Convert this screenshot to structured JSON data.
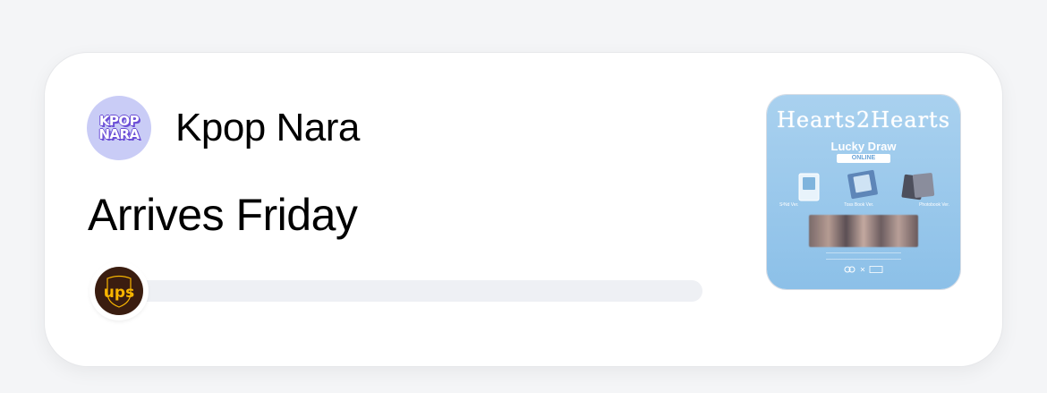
{
  "order": {
    "store": {
      "name": "Kpop Nara",
      "logo_text_line1": "KPOP",
      "logo_text_line2": "NARA",
      "logo_background": "#c9ccf6",
      "logo_text_color": "#6c4fd6"
    },
    "arrival_text": "Arrives Friday",
    "shipment_progress": 0.0,
    "carrier": {
      "name_icon": "ups-logo-icon",
      "logo_text": "ups",
      "brown": "#3a1d10",
      "gold": "#f7b500"
    },
    "product_thumbnail": {
      "title_text": "Hearts2Hearts",
      "subtitle": "Lucky Draw",
      "badge": "ONLINE",
      "captions": [
        "S²Nd Ver.",
        "Toss Book Ver.",
        "Photobook Ver."
      ],
      "background": "#9ccaec"
    }
  }
}
